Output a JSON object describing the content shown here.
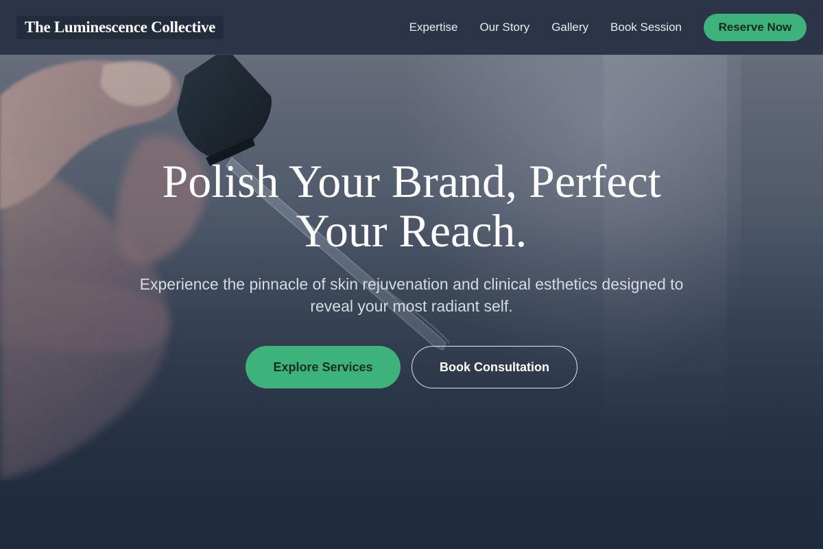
{
  "nav": {
    "brand": "The Luminescence Collective",
    "links": [
      "Expertise",
      "Our Story",
      "Gallery",
      "Book Session"
    ],
    "cta_label": "Reserve Now"
  },
  "hero": {
    "headline": "Polish Your Brand, Perfect Your Reach.",
    "subhead": "Experience the pinnacle of skin rejuvenation and clinical esthetics designed to reveal your most radiant self.",
    "primary_cta": "Explore Services",
    "secondary_cta": "Book Consultation"
  },
  "colors": {
    "accent_green": "#3db27a",
    "nav_background": "#2b3547",
    "hero_dark": "#222d3f"
  },
  "icons": {
    "hero_image": "hand-holding-dropper-image"
  }
}
